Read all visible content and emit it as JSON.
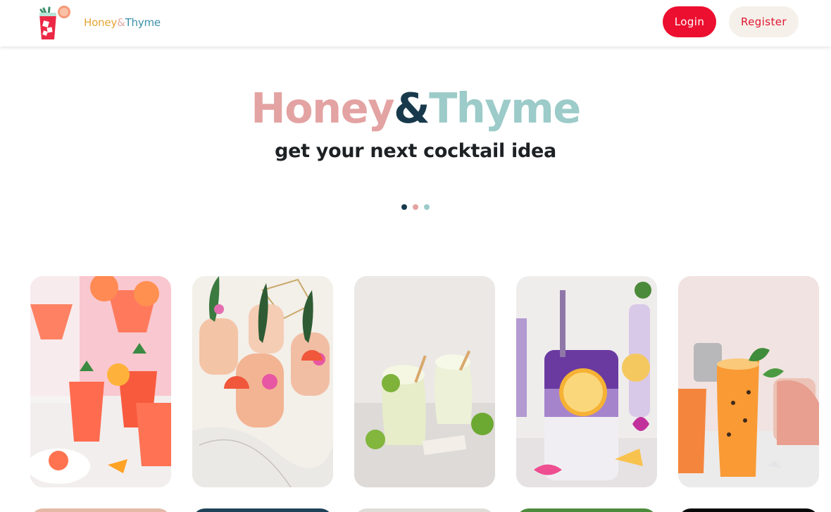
{
  "brand": {
    "word1": "Honey",
    "ampersand": "&",
    "word2": "Thyme",
    "logo_icon": "cocktail-glass-icon"
  },
  "nav": {
    "login_label": "Login",
    "register_label": "Register"
  },
  "hero": {
    "title_word1": "Honey",
    "title_ampersand": "&",
    "title_word2": "Thyme",
    "subtitle": "get your next cocktail idea"
  },
  "carousel": {
    "dot_colors": [
      "#17394b",
      "#e3a3a2",
      "#9ccbc9"
    ],
    "active_index": 0
  },
  "colors": {
    "login_bg": "#ec0f2f",
    "register_bg": "#f5f0ea",
    "title_pink": "#e3a3a2",
    "title_dark": "#17394b",
    "title_teal": "#9ccbc9"
  },
  "cocktail_cards": [
    {
      "image": "grapefruit-cocktails-photo"
    },
    {
      "image": "tropical-grapefruit-cocktails-photo"
    },
    {
      "image": "frozen-margaritas-photo"
    },
    {
      "image": "lavender-lemonade-photo"
    },
    {
      "image": "passionfruit-cocktail-photo"
    }
  ]
}
